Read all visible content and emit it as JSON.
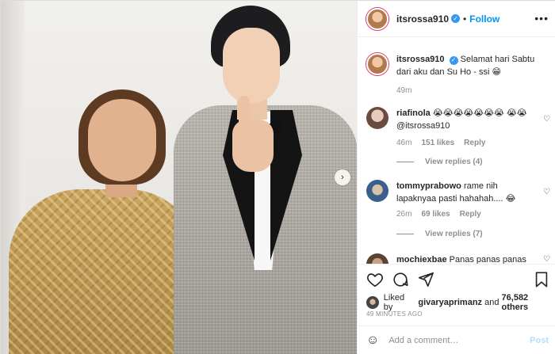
{
  "post": {
    "username": "itsrossa910",
    "follow_label": "Follow",
    "more_label": "•••",
    "next_label": "›"
  },
  "comments": [
    {
      "user": "itsrossa910",
      "text": "Selamat hari Sabtu dari aku dan Su Ho - ssi 😁",
      "time": "49m"
    },
    {
      "user": "riafinola",
      "text": "😭😭😭😭😭😭😭 😭😭 @itsrossa910",
      "time": "46m",
      "likes": "151 likes",
      "reply_label": "Reply",
      "view_replies": "View replies (4)"
    },
    {
      "user": "tommyprabowo",
      "text": "rame nih lapaknyaa pasti hahahah.... 😂",
      "time": "26m",
      "likes": "69 likes",
      "reply_label": "Reply",
      "view_replies": "View replies (7)"
    },
    {
      "user": "mochiexbae",
      "text": "Panas panas panas"
    }
  ],
  "likes": {
    "prefix": "Liked by",
    "user": "givaryaprimanz",
    "and": "and",
    "others": "76,582 others"
  },
  "timestamp": "49 MINUTES AGO",
  "add_comment": {
    "placeholder": "Add a comment…",
    "post_label": "Post"
  },
  "colors": {
    "link_blue": "#0095f6",
    "verified_blue": "#3897f0",
    "muted": "#8e8e8e",
    "text": "#262626"
  }
}
